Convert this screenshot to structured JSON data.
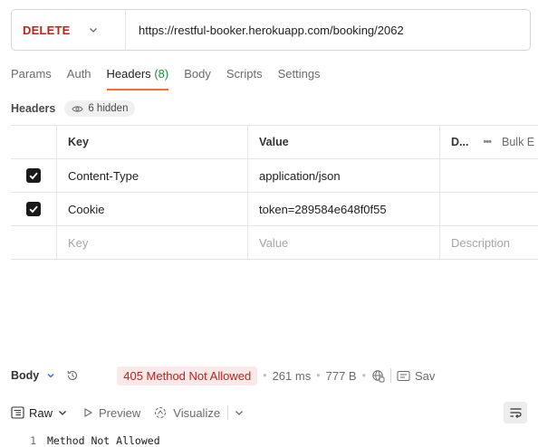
{
  "request": {
    "method": "DELETE",
    "url": "https://restful-booker.herokuapp.com/booking/2062"
  },
  "tabs": [
    {
      "label": "Params"
    },
    {
      "label": "Auth"
    },
    {
      "label": "Headers",
      "count": "(8)"
    },
    {
      "label": "Body"
    },
    {
      "label": "Scripts"
    },
    {
      "label": "Settings"
    }
  ],
  "headers_section": {
    "title": "Headers",
    "hidden_label": "6 hidden"
  },
  "table": {
    "columns": {
      "key": "Key",
      "value": "Value",
      "description": "D...",
      "bulk_edit": "Bulk E"
    },
    "rows": [
      {
        "checked": true,
        "key": "Content-Type",
        "value": "application/json",
        "description": ""
      },
      {
        "checked": true,
        "key": "Cookie",
        "value": "token=289584e648f0f55",
        "description": ""
      }
    ],
    "placeholders": {
      "key": "Key",
      "value": "Value",
      "description": "Description"
    }
  },
  "response": {
    "body_label": "Body",
    "status": "405 Method Not Allowed",
    "time": "261 ms",
    "size": "777 B",
    "save_label": "Sav",
    "view_mode": "Raw",
    "preview_label": "Preview",
    "visualize_label": "Visualize",
    "lines": [
      {
        "num": "1",
        "text": "Method Not Allowed"
      }
    ]
  },
  "colors": {
    "method": "#b3261e",
    "active_tab_underline": "#ff6c37",
    "headers_count": "#1f8a3a",
    "status_bg": "#fde8e8",
    "status_text": "#b3261e"
  }
}
